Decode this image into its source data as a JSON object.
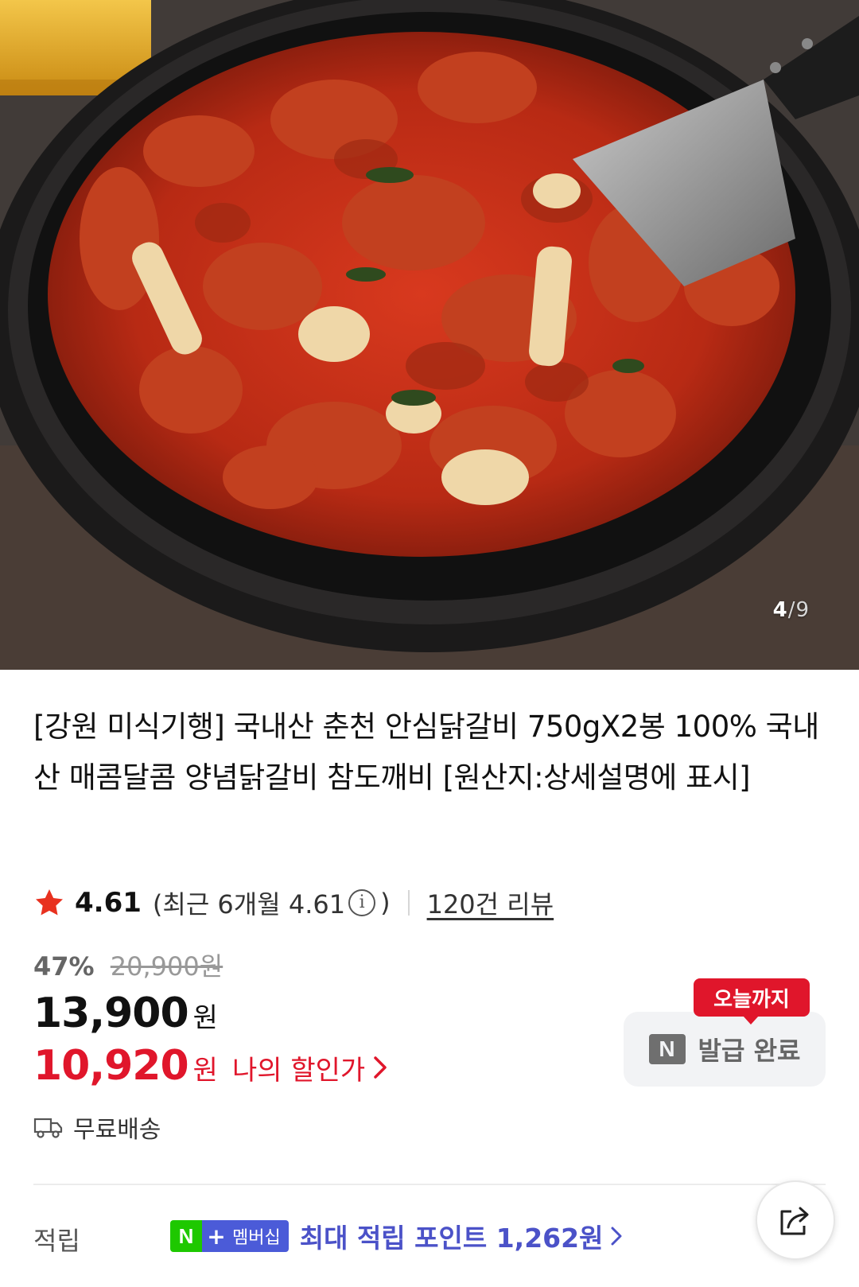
{
  "gallery": {
    "current": "4",
    "separator": "/",
    "total": "9"
  },
  "product": {
    "title": "[강원 미식기행] 국내산 춘천 안심닭갈비 750gX2봉 100% 국내산 매콤달콤 양념닭갈비 참도깨비 [원산지:상세설명에 표시]"
  },
  "rating": {
    "score": "4.61",
    "recent_prefix": "(최근 6개월 4.61",
    "recent_suffix": ")",
    "review_count": "120건 리뷰"
  },
  "price": {
    "discount_rate": "47%",
    "original": "20,900원",
    "current": "13,900",
    "currency": "원",
    "my_price": "10,920",
    "my_price_label": "나의 할인가"
  },
  "coupon": {
    "badge": "오늘까지",
    "label": "발급 완료",
    "logo_letter": "N"
  },
  "delivery": {
    "label": "무료배송"
  },
  "points": {
    "label": "적립",
    "badge_n": "N",
    "badge_plus": "+",
    "badge_text": "멤버십",
    "text": "최대 적립 포인트 1,262원"
  },
  "colors": {
    "accent_red": "#e0162b",
    "points_blue": "#4b52c8",
    "naver_green": "#1ec800"
  }
}
